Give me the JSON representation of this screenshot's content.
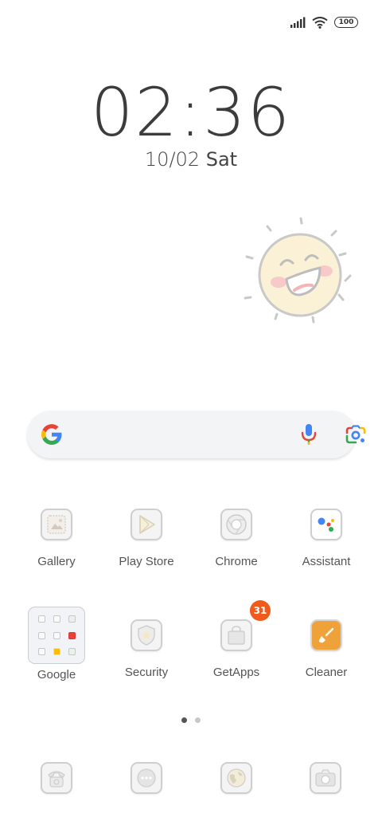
{
  "status_bar": {
    "battery_level": "100"
  },
  "clock": {
    "time": "02:36",
    "date": "10/02",
    "weekday": "Sat"
  },
  "apps_row1": [
    {
      "label": "Gallery"
    },
    {
      "label": "Play Store"
    },
    {
      "label": "Chrome"
    },
    {
      "label": "Assistant"
    }
  ],
  "apps_row2": [
    {
      "label": "Google"
    },
    {
      "label": "Security"
    },
    {
      "label": "GetApps"
    },
    {
      "label": "Cleaner"
    }
  ],
  "getapps_badge": "31",
  "page_indicator": {
    "pages": 2,
    "current": 1
  },
  "dock": [
    {
      "icon": "phone-icon"
    },
    {
      "icon": "messages-icon"
    },
    {
      "icon": "browser-icon"
    },
    {
      "icon": "camera-icon"
    }
  ],
  "colors": {
    "badge": "#f05a1a",
    "cleaner": "#f0a23a",
    "sun_face": "#fbf1d6"
  }
}
